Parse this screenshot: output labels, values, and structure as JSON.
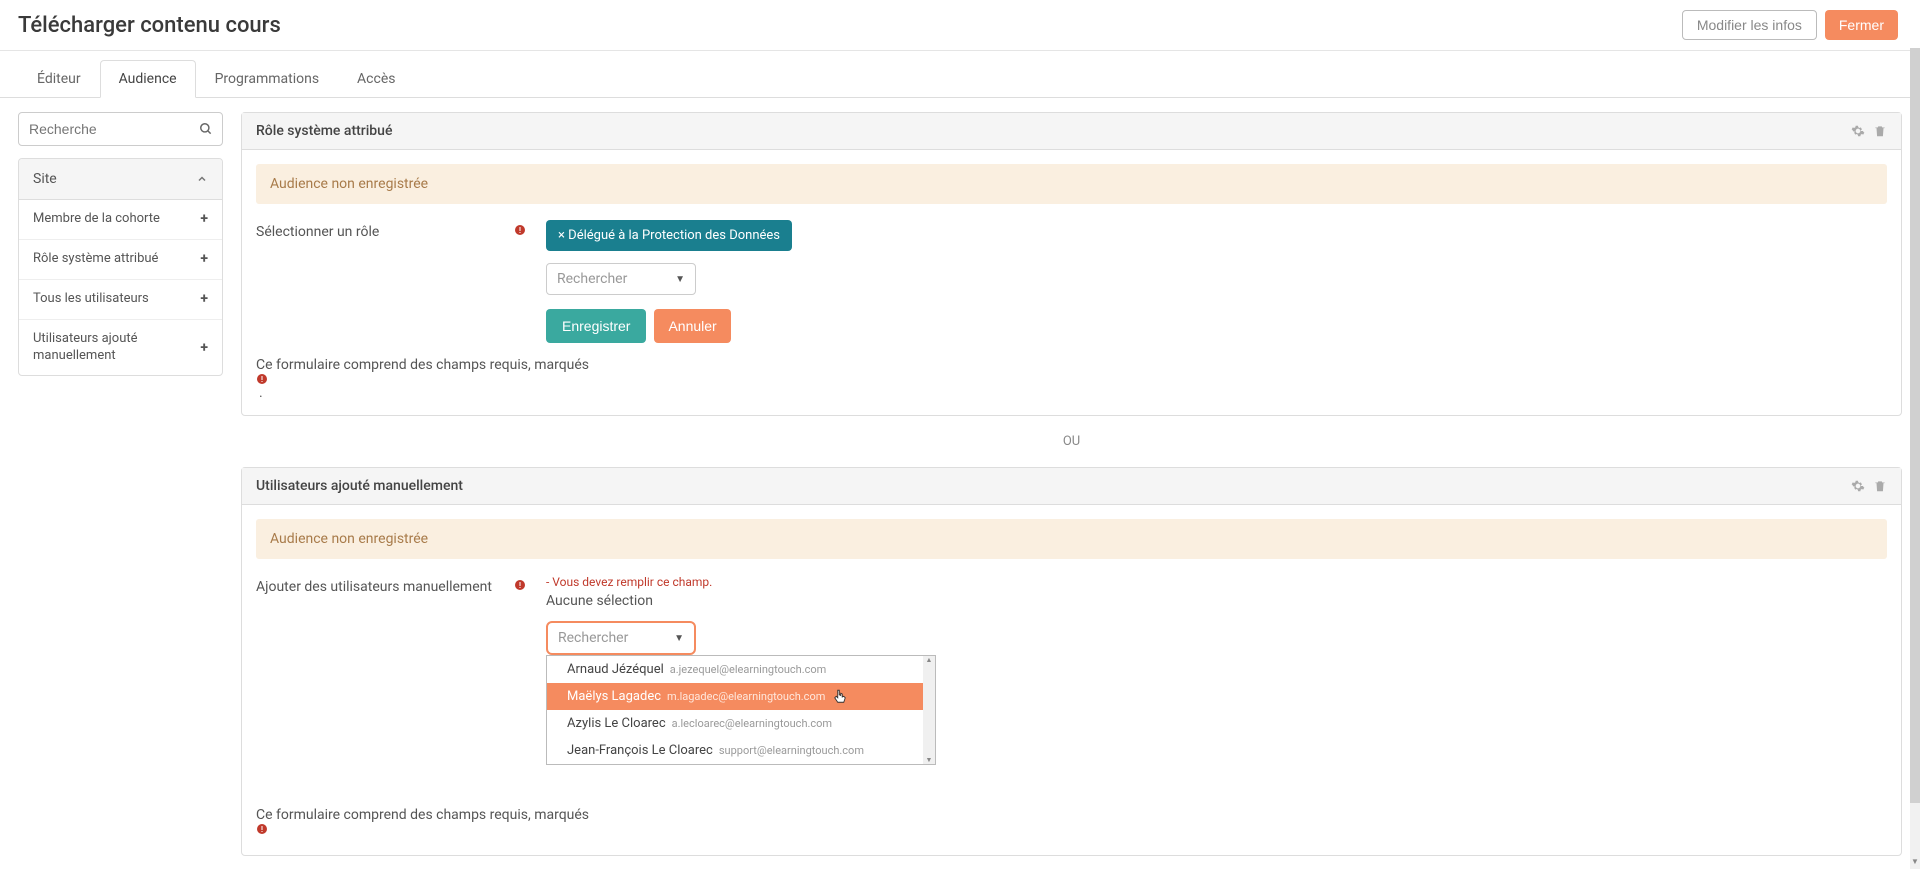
{
  "header": {
    "title": "Télécharger contenu cours",
    "modify_btn": "Modifier les infos",
    "close_btn": "Fermer"
  },
  "tabs": {
    "editor": "Éditeur",
    "audience": "Audience",
    "schedules": "Programmations",
    "access": "Accès"
  },
  "sidebar": {
    "search_placeholder": "Recherche",
    "section_title": "Site",
    "items": [
      {
        "label": "Membre de la cohorte"
      },
      {
        "label": "Rôle système attribué"
      },
      {
        "label": "Tous les utilisateurs"
      },
      {
        "label": "Utilisateurs ajouté manuellement"
      }
    ]
  },
  "card_role": {
    "title": "Rôle système attribué",
    "warn": "Audience non enregistrée",
    "select_label": "Sélectionner un rôle",
    "chip": "× Délégué à la Protection des Données",
    "search_placeholder": "Rechercher",
    "save_btn": "Enregistrer",
    "cancel_btn": "Annuler",
    "footer": "Ce formulaire comprend des champs requis, marqués",
    "footer_end": "."
  },
  "divider": "OU",
  "card_manual": {
    "title": "Utilisateurs ajouté manuellement",
    "warn": "Audience non enregistrée",
    "add_label": "Ajouter des utilisateurs manuellement",
    "error": "- Vous devez remplir ce champ.",
    "none_selected": "Aucune sélection",
    "search_placeholder": "Rechercher",
    "footer": "Ce formulaire comprend des champs requis, marqués",
    "options": [
      {
        "name": "Arnaud Jézéquel",
        "email": "a.jezequel@elearningtouch.com",
        "highlight": false
      },
      {
        "name": "Maëlys Lagadec",
        "email": "m.lagadec@elearningtouch.com",
        "highlight": true
      },
      {
        "name": "Azylis Le Cloarec",
        "email": "a.lecloarec@elearningtouch.com",
        "highlight": false
      },
      {
        "name": "Jean-François Le Cloarec",
        "email": "support@elearningtouch.com",
        "highlight": false
      }
    ]
  }
}
